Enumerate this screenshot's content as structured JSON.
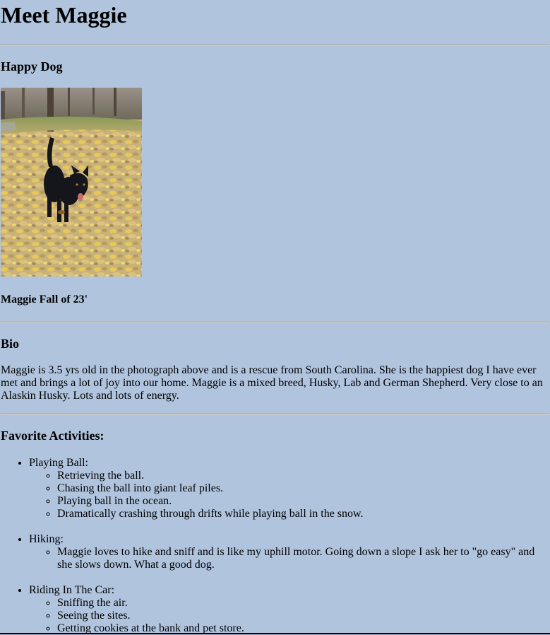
{
  "page": {
    "title": "Meet Maggie",
    "background_color": "#b0c4de"
  },
  "happy_dog": {
    "heading": "Happy Dog",
    "caption": "Maggie Fall of 23'"
  },
  "bio": {
    "heading": "Bio",
    "text": "Maggie is 3.5 yrs old in the photograph above and is a rescue from South Carolina. She is the happiest dog I have ever met and brings a lot of joy into our home. Maggie is a mixed breed, Husky, Lab and German Shepherd. Very close to an Alaskin Husky. Lots and lots of energy."
  },
  "activities": {
    "heading": "Favorite Activities:",
    "items": [
      {
        "label": "Playing Ball:",
        "sub": [
          "Retrieving the ball.",
          "Chasing the ball into giant leaf piles.",
          "Playing ball in the ocean.",
          "Dramatically crashing through drifts while playing ball in the snow."
        ]
      },
      {
        "label": "Hiking:",
        "sub": [
          "Maggie loves to hike and sniff and is like my uphill motor. Going down a slope I ask her to \"go easy\" and she slows down. What a good dog."
        ]
      },
      {
        "label": "Riding In The Car:",
        "sub": [
          "Sniffing the air.",
          "Seeing the sites.",
          "Getting cookies at the bank and pet store."
        ]
      }
    ]
  }
}
